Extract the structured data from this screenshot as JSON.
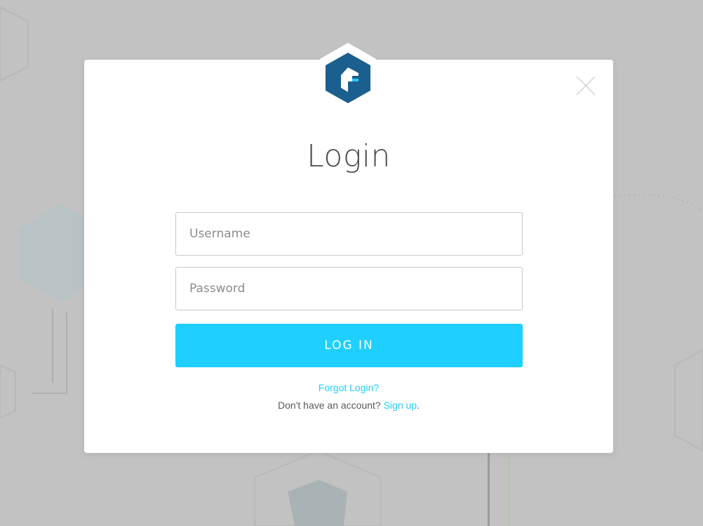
{
  "modal": {
    "title": "Login",
    "username_placeholder": "Username",
    "password_placeholder": "Password",
    "login_label": "LOG IN",
    "forgot_label": "Forgot Login?",
    "signup_prompt": "Don't have an account? ",
    "signup_link": "Sign up",
    "signup_suffix": "."
  },
  "icons": {
    "logo": "brand-hexagon-logo",
    "close": "close-icon"
  },
  "colors": {
    "accent": "#1ecfff",
    "logo_blue": "#1b5f8e",
    "backdrop": "#c2c2c2"
  }
}
